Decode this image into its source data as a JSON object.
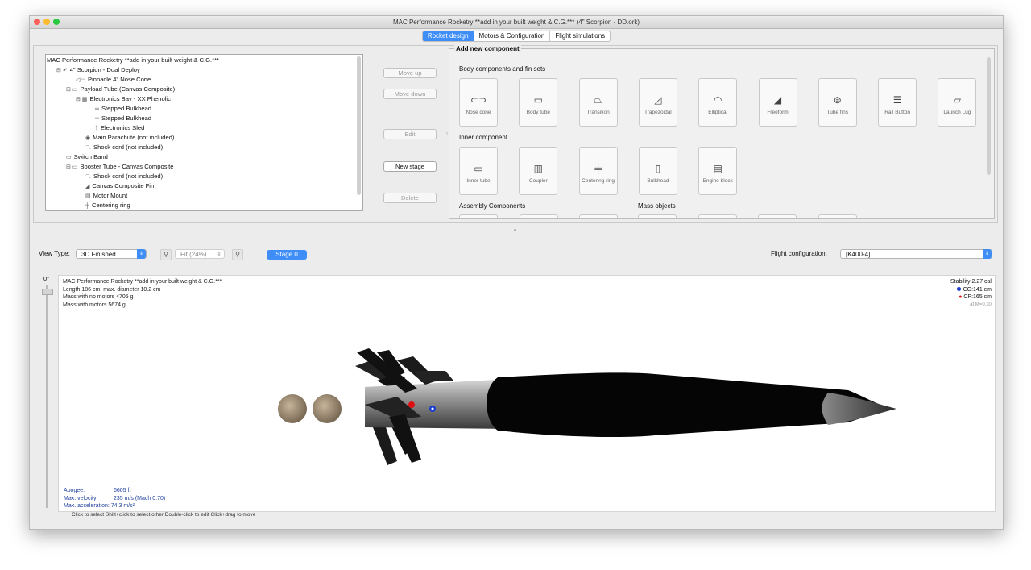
{
  "window": {
    "title": "MAC Performance Rocketry **add in your built weight & C.G.*** (4\" Scorpion - DD.ork)"
  },
  "tabs": [
    "Rocket design",
    "Motors & Configuration",
    "Flight simulations"
  ],
  "tree": {
    "rows": [
      {
        "indent": 0,
        "icon": "",
        "label": "MAC Performance Rocketry **add in your built weight & C.G.***"
      },
      {
        "indent": 1,
        "icon": "⊟ ✔",
        "label": "4\" Scorpion - Dual Deploy"
      },
      {
        "indent": 3,
        "icon": "◁▭",
        "label": "Pinnacle 4\" Nose Cone"
      },
      {
        "indent": 2,
        "icon": "⊟ ▭",
        "label": "Payload Tube (Canvas Composite)"
      },
      {
        "indent": 3,
        "icon": "⊟ ▦",
        "label": "Electronics Bay - XX Phenolic"
      },
      {
        "indent": 5,
        "icon": "╪",
        "label": "Stepped Bulkhead"
      },
      {
        "indent": 5,
        "icon": "╪",
        "label": "Stepped Bulkhead"
      },
      {
        "indent": 5,
        "icon": "†",
        "label": "Electronics Sled"
      },
      {
        "indent": 4,
        "icon": "◉",
        "label": "Main Parachute (not included)"
      },
      {
        "indent": 4,
        "icon": "〽",
        "label": "Shock cord (not included)"
      },
      {
        "indent": 2,
        "icon": "▭",
        "label": "Switch Band"
      },
      {
        "indent": 2,
        "icon": "⊟ ▭",
        "label": "Booster Tube - Canvas Composite"
      },
      {
        "indent": 4,
        "icon": "〽",
        "label": "Shock cord (not included)"
      },
      {
        "indent": 4,
        "icon": "◢",
        "label": "Canvas Composite Fin"
      },
      {
        "indent": 4,
        "icon": "▤",
        "label": "Motor Mount"
      },
      {
        "indent": 4,
        "icon": "╪",
        "label": "Centering ring"
      }
    ]
  },
  "buttons": {
    "move_up": "Move up",
    "move_down": "Move down",
    "edit": "Edit",
    "new_stage": "New stage",
    "delete": "Delete"
  },
  "add_panel": {
    "title": "Add new component",
    "body_section": "Body components and fin sets",
    "body_items": [
      "Nose cone",
      "Body tube",
      "Transition",
      "Trapezoidal",
      "Elliptical",
      "Freeform",
      "Tube fins",
      "Rail Button",
      "Launch Lug"
    ],
    "inner_section": "Inner component",
    "inner_items": [
      "Inner tube",
      "Coupler",
      "Centering ring",
      "Bulkhead",
      "Engine block"
    ],
    "assembly_section": "Assembly Components",
    "mass_section": "Mass objects"
  },
  "viewbar": {
    "view_type_label": "View Type:",
    "view_type_value": "3D Finished",
    "fit_value": "Fit (24%)",
    "stage_label": "Stage 0",
    "flight_config_label": "Flight configuration:",
    "flight_config_value": "[K400-4]"
  },
  "rotation": "0°",
  "rocket_info": {
    "name": "MAC Performance Rocketry **add in your built weight & C.G.***",
    "length": "Length 186 cm, max. diameter 10.2 cm",
    "mass_no_motors": "Mass with no motors 4705 g",
    "mass_with_motors": "Mass with motors 5674 g"
  },
  "stability": {
    "stability": "Stability:2.27 cal",
    "cg": "CG:141 cm",
    "cp": "CP:165 cm",
    "mach": "at M=0.30",
    "cg_color": "#1a3ccf",
    "cp_color": "#e01010"
  },
  "flight_data": {
    "apogee_label": "Apogee:",
    "apogee_value": "6605 ft",
    "velocity_label": "Max. velocity:",
    "velocity_value": "235 m/s  (Mach 0.70)",
    "accel_label": "Max. acceleration:",
    "accel_value": "74.3 m/s²"
  },
  "hints": "Click to select    Shift+click to select other    Double-click to edit    Click+drag to move"
}
